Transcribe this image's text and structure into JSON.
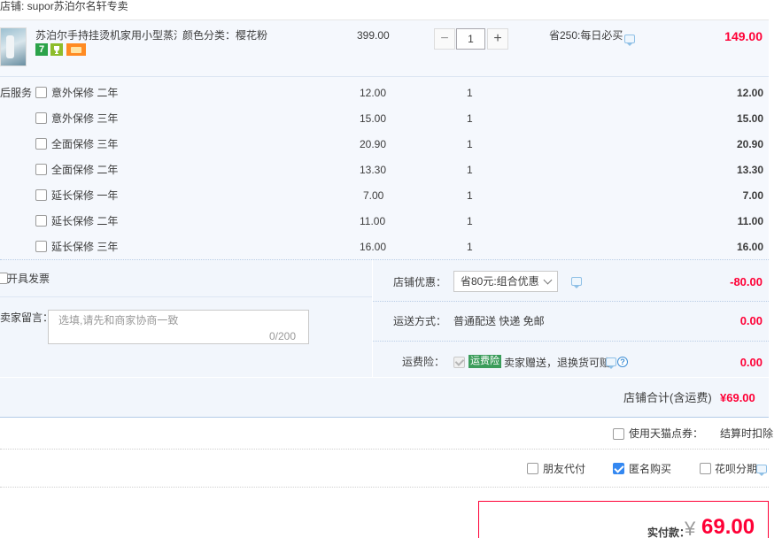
{
  "shop": {
    "title": "店铺: supor苏泊尔名轩专卖"
  },
  "product": {
    "title": "苏泊尔手持挂烫机家用小型蒸汽...",
    "sku": "颜色分类：樱花粉",
    "badges": {
      "seven": "7"
    },
    "unit_price": "399.00",
    "quantity": "1",
    "qty_minus": "−",
    "qty_plus": "+",
    "promotion": "省250:每日必买",
    "subtotal": "149.00"
  },
  "services": {
    "label": "后服务",
    "items": [
      {
        "name": "意外保修  二年",
        "price": "12.00",
        "qty": "1",
        "total": "12.00"
      },
      {
        "name": "意外保修  三年",
        "price": "15.00",
        "qty": "1",
        "total": "15.00"
      },
      {
        "name": "全面保修  三年",
        "price": "20.90",
        "qty": "1",
        "total": "20.90"
      },
      {
        "name": "全面保修  二年",
        "price": "13.30",
        "qty": "1",
        "total": "13.30"
      },
      {
        "name": "延长保修  一年",
        "price": "7.00",
        "qty": "1",
        "total": "7.00"
      },
      {
        "name": "延长保修  二年",
        "price": "11.00",
        "qty": "1",
        "total": "11.00"
      },
      {
        "name": "延长保修  三年",
        "price": "16.00",
        "qty": "1",
        "total": "16.00"
      }
    ]
  },
  "invoice": {
    "label": "开具发票"
  },
  "message": {
    "label": "卖家留言：",
    "placeholder": "选填,请先和商家协商一致",
    "count": "0/200"
  },
  "store_discount": {
    "label": "店铺优惠：",
    "selected": "省80元:组合优惠",
    "amount": "-80.00"
  },
  "shipping": {
    "label": "运送方式：",
    "value": "普通配送 快递 免邮",
    "amount": "0.00"
  },
  "freight_insurance": {
    "label": "运费险：",
    "badge": "运费险",
    "value": "卖家赠送，退换货可赔",
    "help": "?",
    "amount": "0.00"
  },
  "store_total": {
    "label": "店铺合计(含运费)",
    "amount": "¥69.00"
  },
  "points": {
    "label": "使用天猫点券：",
    "status": "结算时扣除"
  },
  "options": {
    "friend_pay": "朋友代付",
    "anonymous": "匿名购买",
    "huabei": "花呗分期"
  },
  "payment": {
    "label": "实付款：",
    "currency": "¥",
    "amount": "69.00"
  },
  "colors": {
    "accent": "#ff0036",
    "panel": "#f2f6fc",
    "checkbox": "#3488f1"
  }
}
